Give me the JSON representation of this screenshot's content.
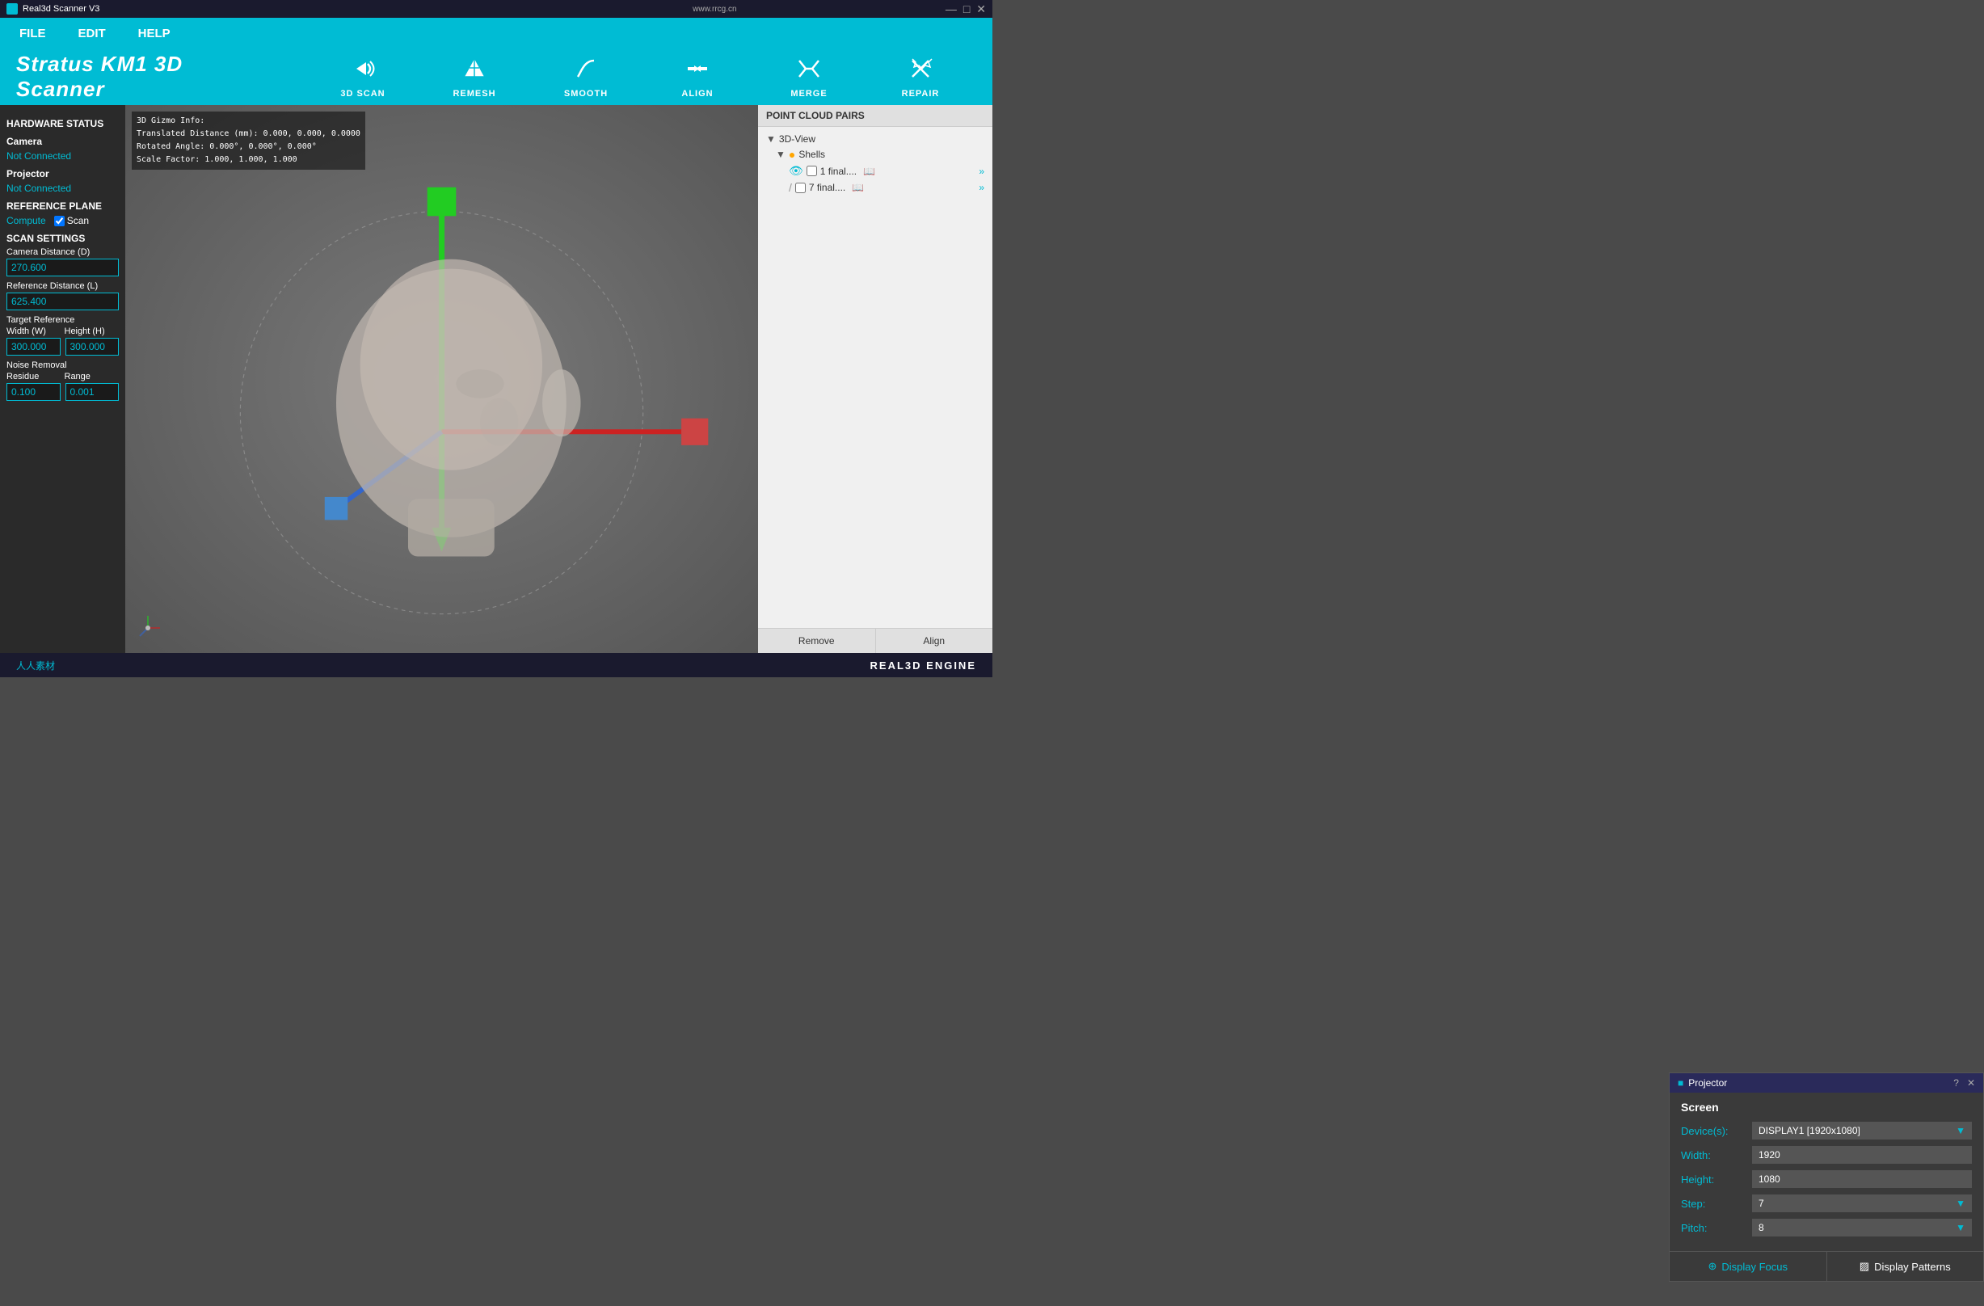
{
  "titlebar": {
    "icon": "■",
    "title": "Real3d Scanner V3",
    "url": "www.rrcg.cn",
    "minimize": "—",
    "maximize": "□",
    "close": "✕"
  },
  "menubar": {
    "items": [
      "FILE",
      "EDIT",
      "HELP"
    ]
  },
  "app": {
    "title": "Stratus KM1 3D Scanner"
  },
  "toolbar": {
    "items": [
      {
        "id": "3dscan",
        "label": "3D SCAN",
        "icon": "◁)"
      },
      {
        "id": "remesh",
        "label": "REMESH",
        "icon": "△"
      },
      {
        "id": "smooth",
        "label": "SMOOTH",
        "icon": "∫"
      },
      {
        "id": "align",
        "label": "ALIGN",
        "icon": "⊣⊢"
      },
      {
        "id": "merge",
        "label": "MERGE",
        "icon": "⇄"
      },
      {
        "id": "repair",
        "label": "REPAIR",
        "icon": "✕"
      }
    ]
  },
  "left_panel": {
    "hardware_status_title": "HARDWARE STATUS",
    "camera_label": "Camera",
    "camera_status": "Not Connected",
    "projector_label": "Projector",
    "projector_status": "Not Connected",
    "reference_plane_title": "REFERENCE PLANE",
    "compute_label": "Compute",
    "scan_label": "Scan",
    "scan_checked": true,
    "scan_settings_title": "SCAN SETTINGS",
    "camera_distance_label": "Camera Distance (D)",
    "camera_distance_value": "270.600",
    "reference_distance_label": "Reference Distance (L)",
    "reference_distance_value": "625.400",
    "target_reference_label": "Target Reference",
    "width_label": "Width (W)",
    "height_label": "Height (H)",
    "width_value": "300.000",
    "height_value": "300.000",
    "noise_removal_label": "Noise Removal",
    "residue_label": "Residue",
    "range_label": "Range",
    "residue_value": "0.100",
    "range_value": "0.001"
  },
  "viewport": {
    "gizmo_info": {
      "line1": "3D Gizmo Info:",
      "line2": "Translated Distance (mm): 0.000, 0.000, 0.0000",
      "line3": "Rotated Angle: 0.000°, 0.000°, 0.000°",
      "line4": "Scale Factor: 1.000, 1.000, 1.000"
    }
  },
  "point_cloud": {
    "header": "POINT CLOUD PAIRS",
    "tree": {
      "view_3d": "3D-View",
      "shells_label": "Shells",
      "item1_label": "1 final....",
      "item2_label": "7 final....",
      "remove_btn": "Remove",
      "align_btn": "Align"
    }
  },
  "projector_dialog": {
    "title": "Projector",
    "question_mark": "?",
    "close": "✕",
    "screen_title": "Screen",
    "devices_label": "Device(s):",
    "devices_value": "DISPLAY1 [1920x1080]",
    "width_label": "Width:",
    "width_value": "1920",
    "height_label": "Height:",
    "height_value": "1080",
    "step_label": "Step:",
    "step_value": "7",
    "pitch_label": "Pitch:",
    "pitch_value": "8",
    "display_focus_label": "Display Focus",
    "display_patterns_label": "Display Patterns"
  },
  "bottom_bar": {
    "logo": "REAL3D  ENGINE",
    "watermark": "人人素材"
  }
}
